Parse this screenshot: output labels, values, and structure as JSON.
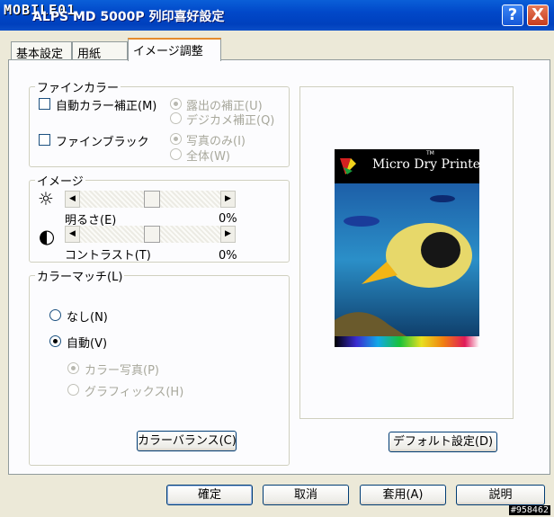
{
  "window": {
    "logo": "MOBILE01",
    "title": "ALPS MD 5000P 列印喜好設定",
    "help_glyph": "?",
    "close_glyph": "X"
  },
  "tabs": [
    {
      "label": "基本設定"
    },
    {
      "label": "用紙"
    },
    {
      "label": "イメージ調整"
    }
  ],
  "fine_color": {
    "title": "ファインカラー",
    "auto_correct": {
      "label": "自動カラー補正(M)",
      "checked": false
    },
    "fine_black": {
      "label": "ファインブラック",
      "checked": false
    },
    "exposure_correct": "露出の補正(U)",
    "digicam_correct": "デジカメ補正(Q)",
    "photo_only": "写真のみ(I)",
    "whole": "全体(W)"
  },
  "image": {
    "title": "イメージ",
    "brightness": {
      "label": "明るさ(E)",
      "value": "0%"
    },
    "contrast": {
      "label": "コントラスト(T)",
      "value": "0%"
    },
    "sun_glyph": "☼",
    "contrast_glyph": "◐",
    "left_arrow": "◀",
    "right_arrow": "▶"
  },
  "color_match": {
    "title": "カラーマッチ(L)",
    "none": {
      "label": "なし(N)",
      "selected": false
    },
    "auto": {
      "label": "自動(V)",
      "selected": true
    },
    "color_photo": {
      "label": "カラー写真(P)",
      "selected": true,
      "disabled": true
    },
    "graphics": {
      "label": "グラフィックス(H)",
      "selected": false,
      "disabled": true
    },
    "balance_button": "カラーバランス(C)"
  },
  "preview": {
    "brand": "Micro Dry Printer",
    "tm": "TM",
    "default_button": "デフォルト設定(D)"
  },
  "footer": {
    "ok": "確定",
    "cancel": "取消",
    "apply": "套用(A)",
    "help": "説明"
  },
  "watermark": "#958462",
  "colors": {
    "titlebar": "#0048c8",
    "tab_highlight": "#e68b2c",
    "dialog_bg": "#ece9d8"
  }
}
